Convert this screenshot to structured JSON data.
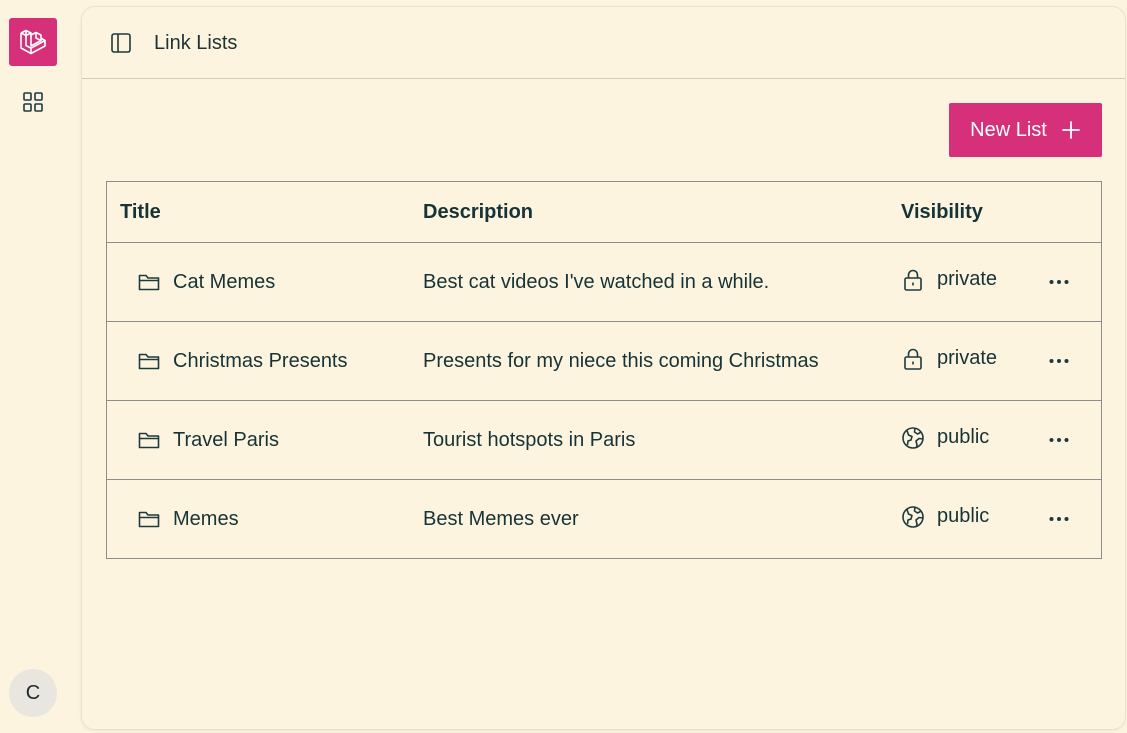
{
  "header": {
    "title": "Link Lists"
  },
  "toolbar": {
    "new_list_label": "New List"
  },
  "user": {
    "avatar_initial": "C"
  },
  "table": {
    "columns": [
      "Title",
      "Description",
      "Visibility"
    ],
    "rows": [
      {
        "title": "Cat Memes",
        "description": "Best cat videos I've watched in a while.",
        "visibility": "private",
        "visibility_icon": "lock-icon"
      },
      {
        "title": "Christmas Presents",
        "description": "Presents for my niece this coming Christmas",
        "visibility": "private",
        "visibility_icon": "lock-icon"
      },
      {
        "title": "Travel Paris",
        "description": "Tourist hotspots in Paris",
        "visibility": "public",
        "visibility_icon": "globe-icon"
      },
      {
        "title": "Memes",
        "description": "Best Memes ever",
        "visibility": "public",
        "visibility_icon": "globe-icon"
      }
    ]
  },
  "icons": {
    "logo": "laravel-logo-icon",
    "apps": "grid-icon",
    "sidebar_toggle": "sidebar-toggle-icon",
    "new_list": "plus-icon",
    "row_folder": "folder-icon",
    "row_more": "more-horizontal-icon"
  },
  "colors": {
    "accent": "#d6307a",
    "background": "#fdf4e0",
    "text": "#163337",
    "border": "#8d8e8c",
    "avatar_bg": "#e9e6e0"
  }
}
